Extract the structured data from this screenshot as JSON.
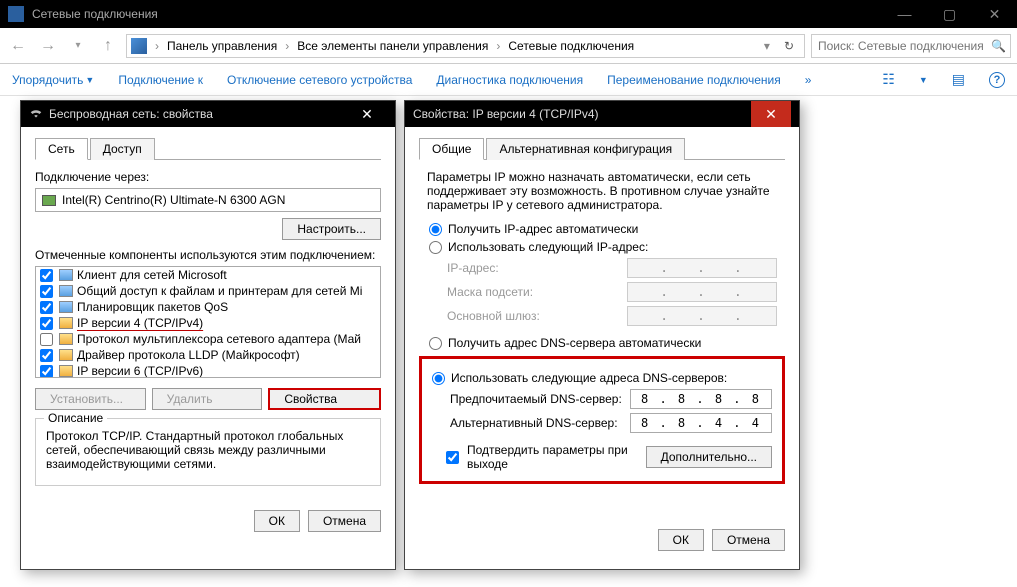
{
  "window": {
    "title": "Сетевые подключения"
  },
  "breadcrumb": {
    "seg1": "Панель управления",
    "seg2": "Все элементы панели управления",
    "seg3": "Сетевые подключения"
  },
  "search": {
    "placeholder": "Поиск: Сетевые подключения"
  },
  "toolbar": {
    "organize": "Упорядочить",
    "connect": "Подключение к",
    "disable": "Отключение сетевого устройства",
    "diagnose": "Диагностика подключения",
    "rename": "Переименование подключения"
  },
  "dlg1": {
    "title": "Беспроводная сеть: свойства",
    "tabs": {
      "net": "Сеть",
      "access": "Доступ"
    },
    "connect_via": "Подключение через:",
    "adapter": "Intel(R) Centrino(R) Ultimate-N 6300 AGN",
    "configure": "Настроить...",
    "components_label": "Отмеченные компоненты используются этим подключением:",
    "components": [
      {
        "name": "Клиент для сетей Microsoft",
        "checked": true,
        "icon": "net"
      },
      {
        "name": "Общий доступ к файлам и принтерам для сетей Mi",
        "checked": true,
        "icon": "net"
      },
      {
        "name": "Планировщик пакетов QoS",
        "checked": true,
        "icon": "net"
      },
      {
        "name": "IP версии 4 (TCP/IPv4)",
        "checked": true,
        "icon": "proto",
        "selected": true
      },
      {
        "name": "Протокол мультиплексора сетевого адаптера (Май",
        "checked": false,
        "icon": "proto"
      },
      {
        "name": "Драйвер протокола LLDP (Майкрософт)",
        "checked": true,
        "icon": "proto"
      },
      {
        "name": "IP версии 6 (TCP/IPv6)",
        "checked": true,
        "icon": "proto"
      }
    ],
    "install": "Установить...",
    "uninstall": "Удалить",
    "properties": "Свойства",
    "desc_legend": "Описание",
    "desc_text": "Протокол TCP/IP. Стандартный протокол глобальных сетей, обеспечивающий связь между различными взаимодействующими сетями.",
    "ok": "ОК",
    "cancel": "Отмена"
  },
  "dlg2": {
    "title": "Свойства: IP версии 4 (TCP/IPv4)",
    "tabs": {
      "general": "Общие",
      "alt": "Альтернативная конфигурация"
    },
    "intro": "Параметры IP можно назначать автоматически, если сеть поддерживает эту возможность. В противном случае узнайте параметры IP у сетевого администратора.",
    "r_auto_ip": "Получить IP-адрес автоматически",
    "r_static_ip": "Использовать следующий IP-адрес:",
    "lbl_ip": "IP-адрес:",
    "lbl_mask": "Маска подсети:",
    "lbl_gw": "Основной шлюз:",
    "r_auto_dns": "Получить адрес DNS-сервера автоматически",
    "r_static_dns": "Использовать следующие адреса DNS-серверов:",
    "lbl_pref_dns": "Предпочитаемый DNS-сервер:",
    "lbl_alt_dns": "Альтернативный DNS-сервер:",
    "pref_dns": "8 . 8 . 8 . 8",
    "alt_dns": "8 . 8 . 4 . 4",
    "confirm_exit": "Подтвердить параметры при выходе",
    "advanced": "Дополнительно...",
    "ok": "ОК",
    "cancel": "Отмена"
  }
}
